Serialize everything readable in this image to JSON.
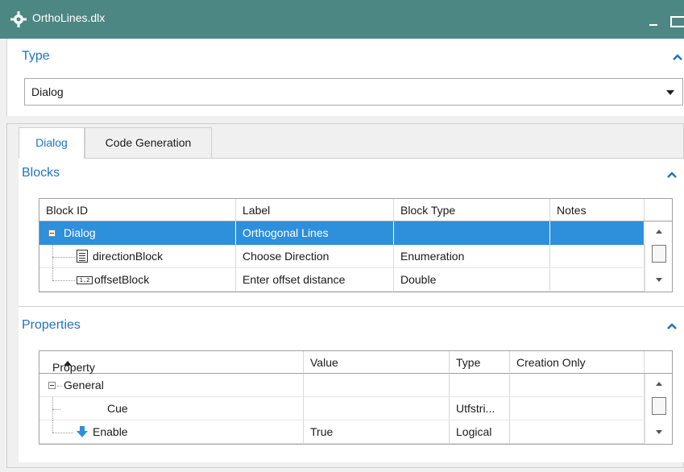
{
  "window": {
    "title": "OrthoLines.dlx",
    "icon": "gear-icon",
    "colors": {
      "titlebar": "#4d8784",
      "accent": "#1e73be",
      "selection": "#2e8fdb"
    }
  },
  "type_section": {
    "title": "Type",
    "selected": "Dialog"
  },
  "tabs": [
    {
      "label": "Dialog",
      "active": true
    },
    {
      "label": "Code Generation",
      "active": false
    }
  ],
  "blocks": {
    "title": "Blocks",
    "columns": [
      "Block ID",
      "Label",
      "Block Type",
      "Notes"
    ],
    "rows": [
      {
        "id": "Dialog",
        "label": "Orthogonal Lines",
        "type": "",
        "notes": "",
        "selected": true,
        "icon": "expander-icon"
      },
      {
        "id": "directionBlock",
        "label": "Choose Direction",
        "type": "Enumeration",
        "notes": "",
        "icon": "enumeration-icon"
      },
      {
        "id": "offsetBlock",
        "label": "Enter offset distance",
        "type": "Double",
        "notes": "",
        "icon": "double-value-icon"
      }
    ],
    "double_icon_text": "1.2"
  },
  "properties": {
    "title": "Properties",
    "columns": [
      "Property",
      "Value",
      "Type",
      "Creation Only"
    ],
    "rows": [
      {
        "property": "General",
        "value": "",
        "type": "",
        "creation_only": "",
        "icon": "expander-icon"
      },
      {
        "property": "Cue",
        "value": "",
        "type": "Utfstri...",
        "creation_only": ""
      },
      {
        "property": "Enable",
        "value": "True",
        "type": "Logical",
        "creation_only": "",
        "icon": "down-arrow-icon"
      }
    ]
  }
}
